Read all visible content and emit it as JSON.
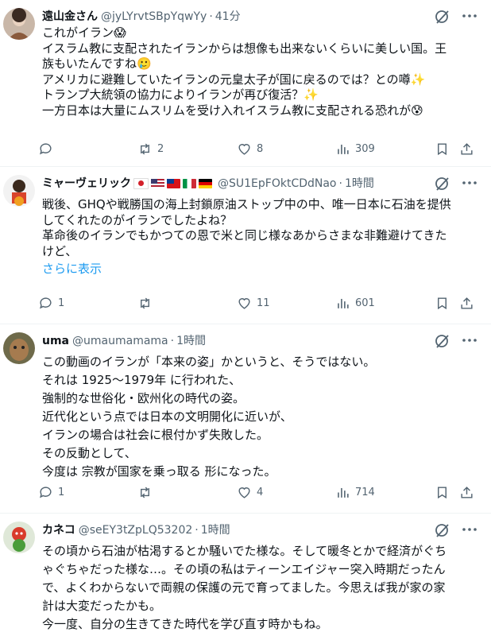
{
  "tweets": [
    {
      "name": "遠山金さん",
      "handle": "@jyLYrvtSBpYqwYy",
      "time": "41分",
      "lines": [
        "これがイラン😱",
        "イスラム教に支配されたイランからは想像も出来ないくらいに美しい国。王",
        "族もいたんですね🥲",
        "アメリカに避難していたイランの元皇太子が国に戻るのでは？との噂✨",
        "トランプ大統領の協力によりイランが再び復活？✨",
        "一方日本は大量にムスリムを受け入れイスラム教に支配される恐れが😰"
      ],
      "replies": "",
      "reposts": "2",
      "likes": "8",
      "views": "309"
    },
    {
      "name": "ミャーヴェリック",
      "handle": "@SU1EpFOktCDdNao",
      "time": "1時間",
      "flags": [
        "Japan",
        "United States",
        "Taiwan",
        "Italy",
        "Germany"
      ],
      "lines": [
        "戦後、GHQや戦勝国の海上封鎖原油ストップ中の中、唯一日本に石油を提供",
        "してくれたのがイランでしたよね？",
        "革命後のイランでもかつての恩で米と同じ様なあからさまな非難避けてきた",
        "けど、"
      ],
      "show_more": "さらに表示",
      "replies": "1",
      "reposts": "",
      "likes": "11",
      "views": "601"
    },
    {
      "name": "uma",
      "handle": "@umaumamama",
      "time": "1時間",
      "lines": [
        "この動画のイランが「本来の姿」かというと、そうではない。",
        "それは 1925〜1979年 に行われた、",
        "強制的な世俗化・欧州化の時代の姿。",
        "近代化という点では日本の文明開化に近いが、",
        "イランの場合は社会に根付かず失敗した。",
        "その反動として、",
        "今度は 宗教が国家を乗っ取る 形になった。"
      ],
      "replies": "1",
      "reposts": "",
      "likes": "4",
      "views": "714"
    },
    {
      "name": "カネコ",
      "handle": "@seEY3tZpLQ53202",
      "time": "1時間",
      "lines": [
        "その頃から石油が枯渇するとか騒いでた様な。そして暖冬とかで経済がぐち",
        "ゃぐちゃだった様な…。その頃の私はティーンエイジャー突入時期だったん",
        "で、よくわからないで両親の保護の元で育ってました。今思えば我が家の家",
        "計は大変だったかも。",
        "今一度、自分の生きてきた時代を学び直す時かもね。"
      ]
    }
  ]
}
